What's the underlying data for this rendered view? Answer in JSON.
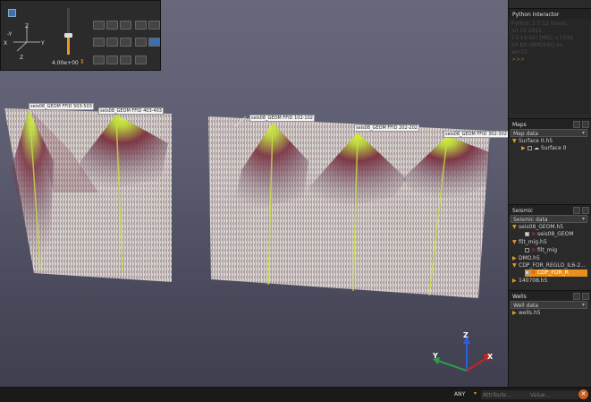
{
  "toolbar": {
    "camera_value": "4.00e+00",
    "axes": {
      "y_left": "-Y",
      "z_top": "Z",
      "x_left": "X",
      "y_right": "Y",
      "z_bottom": "Z"
    }
  },
  "scene": {
    "labels": [
      "seis08_GEOM FFID 503-503",
      "seis08_GEOM FFID 403-403",
      "seis08_GEOM FFID 102-102",
      "seis08_GEOM FFID 202-202",
      "seis08_GEOM FFID 302-302"
    ],
    "triad": {
      "z": "Z",
      "y": "Y",
      "x": "X"
    }
  },
  "python": {
    "title": "Python Interactor",
    "text": [
      "Python 3.7.12 (main,",
      "Jul 15 2022,",
      "13:14:54) [MSC v.1916",
      "64 bit (AMD64)] on",
      "win32",
      ">>> "
    ]
  },
  "maps": {
    "title": "Maps",
    "subhead": "Map data",
    "items": [
      {
        "label": "Surface 0.h5",
        "level": 0,
        "arrow": "down",
        "check": false
      },
      {
        "label": "Surface 0",
        "level": 1,
        "arrow": "right",
        "check": false
      }
    ]
  },
  "seismic": {
    "title": "Seismic",
    "subhead": "Seismic data",
    "items": [
      {
        "label": "seis08_GEOM.h5",
        "level": 0,
        "arrow": "down",
        "check": false
      },
      {
        "label": "seis08_GEOM",
        "level": 1,
        "arrow": "",
        "check": true
      },
      {
        "label": "filt_mig.h5",
        "level": 0,
        "arrow": "down",
        "check": false
      },
      {
        "label": "filt_mig",
        "level": 1,
        "arrow": "",
        "check": false
      },
      {
        "label": "DMO.h5",
        "level": 0,
        "arrow": "right",
        "check": false
      },
      {
        "label": "CDP_FOR_REGLO_IL6-2...",
        "level": 0,
        "arrow": "down",
        "check": false
      },
      {
        "label": "CDP_FOR_R",
        "level": 1,
        "arrow": "",
        "check": true,
        "selected": true
      },
      {
        "label": "140708.h5",
        "level": 0,
        "arrow": "right",
        "check": false
      }
    ]
  },
  "wells": {
    "title": "Wells",
    "subhead": "Well data",
    "items": [
      {
        "label": "wells.h5",
        "level": 0,
        "arrow": "right",
        "check": false
      }
    ]
  },
  "status": {
    "filter": "ANY",
    "attribute_placeholder": "Attribute...",
    "value_placeholder": "Value..."
  },
  "colors": {
    "accent": "#e49a2a",
    "selected": "#e8901a",
    "seismic_peak": "#c8f03c",
    "panel": "#d8d4ce"
  }
}
